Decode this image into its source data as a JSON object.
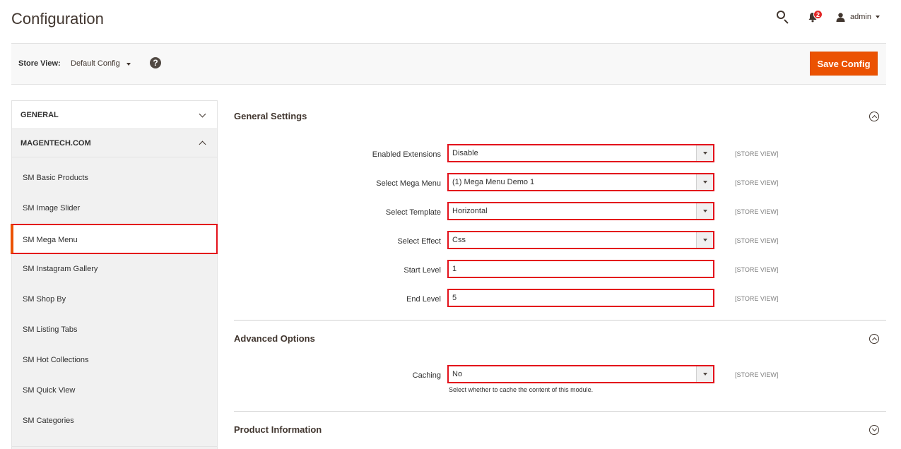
{
  "header": {
    "title": "Configuration",
    "notification_count": "2",
    "user": "admin"
  },
  "toolbar": {
    "store_label": "Store View:",
    "store_value": "Default Config",
    "help": "?",
    "save_label": "Save Config"
  },
  "sidebar": {
    "general": "GENERAL",
    "magentech": "MAGENTECH.COM",
    "items": [
      {
        "label": "SM Basic Products"
      },
      {
        "label": "SM Image Slider"
      },
      {
        "label": "SM Mega Menu"
      },
      {
        "label": "SM Instagram Gallery"
      },
      {
        "label": "SM Shop By"
      },
      {
        "label": "SM Listing Tabs"
      },
      {
        "label": "SM Hot Collections"
      },
      {
        "label": "SM Quick View"
      },
      {
        "label": "SM Categories"
      }
    ]
  },
  "sections": {
    "general": {
      "title": "General Settings",
      "fields": [
        {
          "label": "Enabled Extensions",
          "value": "Disable",
          "scope": "[STORE VIEW]"
        },
        {
          "label": "Select Mega Menu",
          "value": "(1) Mega Menu Demo 1",
          "scope": "[STORE VIEW]"
        },
        {
          "label": "Select Template",
          "value": "Horizontal",
          "scope": "[STORE VIEW]"
        },
        {
          "label": "Select Effect",
          "value": "Css",
          "scope": "[STORE VIEW]"
        },
        {
          "label": "Start Level",
          "value": "1",
          "scope": "[STORE VIEW]"
        },
        {
          "label": "End Level",
          "value": "5",
          "scope": "[STORE VIEW]"
        }
      ]
    },
    "advanced": {
      "title": "Advanced Options",
      "caching_label": "Caching",
      "caching_value": "No",
      "caching_scope": "[STORE VIEW]",
      "caching_note": "Select whether to cache the content of this module."
    },
    "product": {
      "title": "Product Information"
    }
  },
  "colors": {
    "accent": "#eb5202",
    "highlight": "#e3111b"
  }
}
